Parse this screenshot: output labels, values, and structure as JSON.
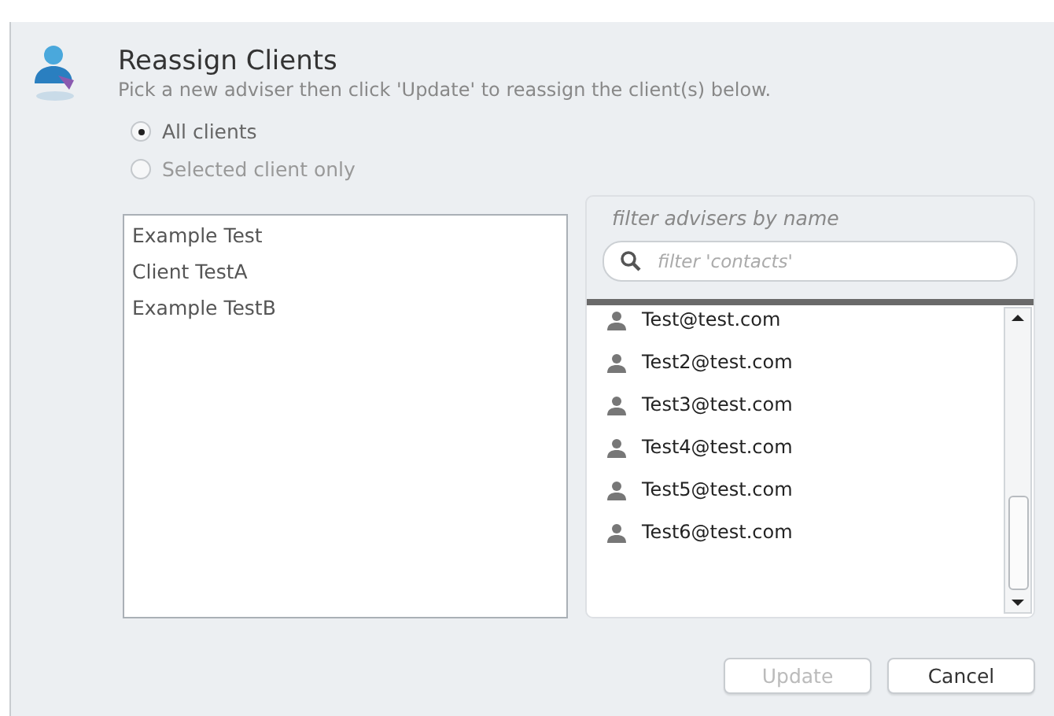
{
  "header": {
    "title": "Reassign Clients",
    "subtitle": "Pick a new adviser then click 'Update' to reassign the client(s) below."
  },
  "scope_options": [
    {
      "label": "All clients",
      "selected": true
    },
    {
      "label": "Selected client only",
      "selected": false
    }
  ],
  "clients": [
    "Example Test",
    "Client TestA",
    "Example TestB"
  ],
  "advisers": {
    "heading": "filter advisers by name",
    "search": {
      "placeholder": "filter 'contacts'"
    },
    "items": [
      "Test@test.com",
      "Test2@test.com",
      "Test3@test.com",
      "Test4@test.com",
      "Test5@test.com",
      "Test6@test.com"
    ]
  },
  "buttons": [
    {
      "label": "Update",
      "disabled": true
    },
    {
      "label": "Cancel",
      "disabled": false
    }
  ]
}
